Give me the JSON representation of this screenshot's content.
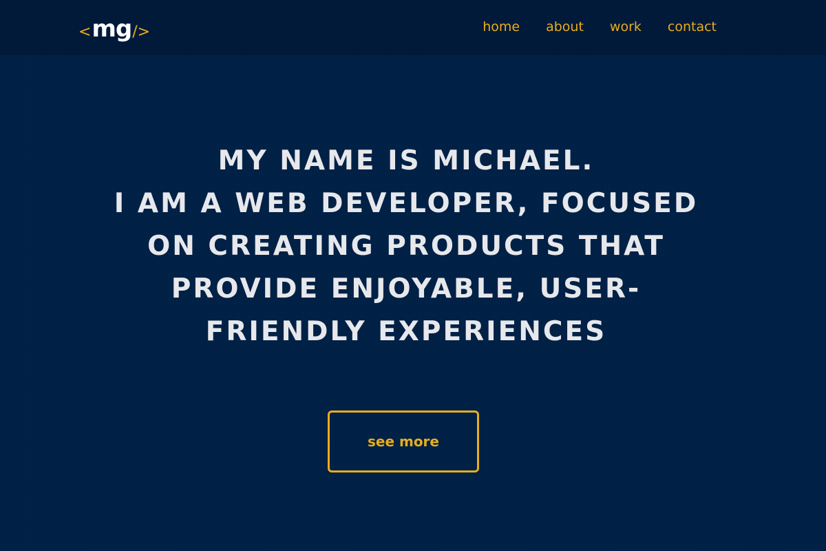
{
  "logo": {
    "open": "<",
    "text": "mg",
    "close": "/>"
  },
  "nav": [
    {
      "label": "home"
    },
    {
      "label": "about"
    },
    {
      "label": "work"
    },
    {
      "label": "contact"
    }
  ],
  "hero": {
    "lines": [
      "MY NAME IS MICHAEL.",
      "I AM A WEB DEVELOPER, FOCUSED",
      "ON CREATING PRODUCTS THAT",
      "PROVIDE ENJOYABLE, USER-",
      "FRIENDLY EXPERIENCES"
    ]
  },
  "cta": {
    "label": "see more"
  },
  "colors": {
    "background": "#002045",
    "navbar": "#011a3a",
    "accent": "#e9ad1c",
    "hero_text": "#e7e8ec"
  }
}
